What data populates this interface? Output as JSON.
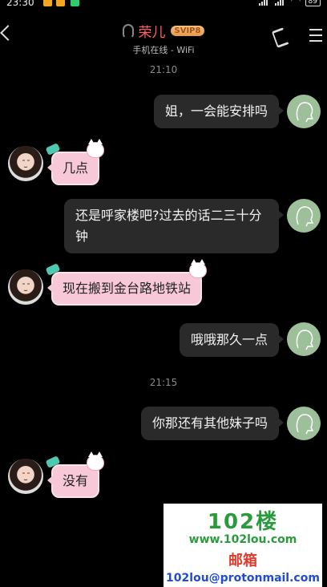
{
  "status_bar": {
    "time": "23:30",
    "battery": "89"
  },
  "header": {
    "contact_name": "荣儿",
    "vip_badge": "SVIP8",
    "online_status": "手机在线 - WiFi"
  },
  "timestamps": [
    "21:10",
    "21:15"
  ],
  "messages": [
    {
      "side": "out",
      "text": "姐，一会能安排吗"
    },
    {
      "side": "in",
      "text": "几点"
    },
    {
      "side": "out",
      "text": "还是呼家楼吧?过去的话二三十分钟"
    },
    {
      "side": "in",
      "text": "现在搬到金台路地铁站"
    },
    {
      "side": "out",
      "text": "哦哦那久一点"
    },
    {
      "side": "out",
      "text": "你那还有其他妹子吗"
    },
    {
      "side": "in",
      "text": "没有"
    }
  ],
  "watermark": {
    "logo": "102楼",
    "url": "www.102lou.com",
    "mailbox": "邮箱",
    "email": "102lou@protonmail.com"
  },
  "colors": {
    "incoming_bubble": "#f6c8d8",
    "outgoing_bubble": "#2a2a2a",
    "name": "#ff5e6a"
  }
}
